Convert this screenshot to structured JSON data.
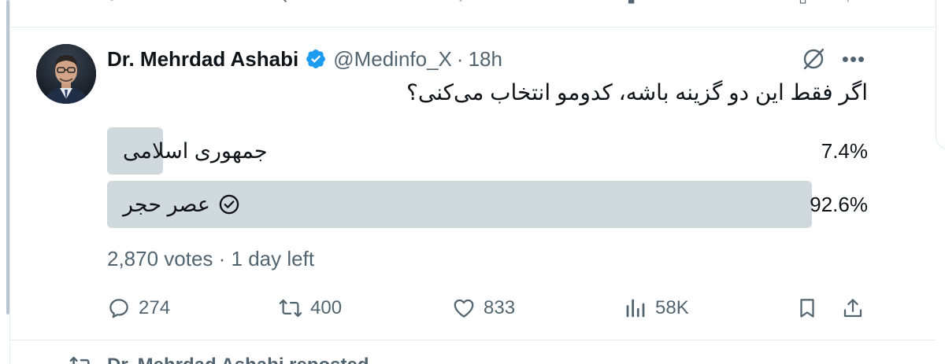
{
  "prev_tweet_actions": {
    "icons": [
      "reply-icon",
      "repost-icon",
      "like-icon",
      "views-icon",
      "bookmark-icon",
      "share-icon"
    ]
  },
  "tweet": {
    "author_name": "Dr. Mehrdad Ashabi",
    "handle": "@Medinfo_X",
    "separator": "·",
    "time": "18h",
    "text": "اگر فقط این دو گزینه باشه، کدومو انتخاب می‌کنی؟",
    "verified_color": "#1d9bf0"
  },
  "poll": {
    "options": [
      {
        "label": "جمهوری اسلامی",
        "percent_text": "7.4%",
        "percent": 7.4,
        "selected": false
      },
      {
        "label": "عصر حجر",
        "percent_text": "92.6%",
        "percent": 92.6,
        "selected": true
      }
    ],
    "meta": "2,870 votes · 1 day left",
    "bar_color": "#cfd9de"
  },
  "actions": {
    "replies": "274",
    "reposts": "400",
    "likes": "833",
    "views": "58K"
  },
  "next_item": {
    "repost_text": "Dr. Mehrdad Ashabi reposted"
  }
}
